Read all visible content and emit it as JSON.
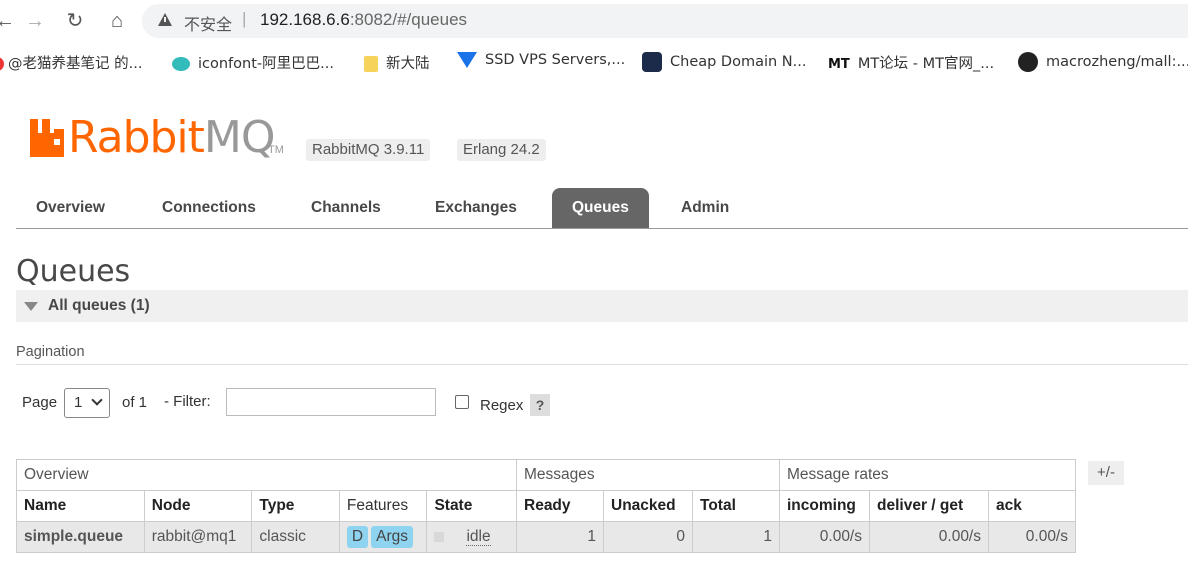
{
  "browser": {
    "insecure_label": "不安全",
    "url_host": "192.168.6.6",
    "url_rest": ":8082/#/queues",
    "bookmarks": [
      {
        "label": "@老猫养基笔记 的..."
      },
      {
        "label": "iconfont-阿里巴巴..."
      },
      {
        "label": "新大陆"
      },
      {
        "label": "SSD VPS Servers,..."
      },
      {
        "label": "Cheap Domain N..."
      },
      {
        "label": "MT论坛 - MT官网_..."
      },
      {
        "label": "macrozheng/mall:..."
      }
    ]
  },
  "app": {
    "logo_brand": "Rabbit",
    "logo_mq": "MQ",
    "tm": "TM",
    "version": "RabbitMQ 3.9.11",
    "erlang": "Erlang 24.2"
  },
  "tabs": [
    "Overview",
    "Connections",
    "Channels",
    "Exchanges",
    "Queues",
    "Admin"
  ],
  "page": {
    "title": "Queues",
    "section": "All queues (1)",
    "pagination_label": "Pagination",
    "page_label": "Page",
    "page_value": "1",
    "of_label": "of 1",
    "filter_label": "- Filter:",
    "filter_value": "",
    "regex_label": "Regex",
    "help": "?",
    "plus_minus": "+/-"
  },
  "table": {
    "groups": [
      "Overview",
      "Messages",
      "Message rates"
    ],
    "columns": [
      "Name",
      "Node",
      "Type",
      "Features",
      "State",
      "Ready",
      "Unacked",
      "Total",
      "incoming",
      "deliver / get",
      "ack"
    ],
    "row": {
      "name": "simple.queue",
      "node": "rabbit@mq1",
      "type": "classic",
      "feature_d": "D",
      "feature_args": "Args",
      "state": "idle",
      "ready": "1",
      "unacked": "0",
      "total": "1",
      "incoming": "0.00/s",
      "deliver_get": "0.00/s",
      "ack": "0.00/s"
    }
  },
  "colors": {
    "brand": "#ff6600",
    "active_tab": "#666666",
    "feature_badge": "#8ed4f0"
  }
}
